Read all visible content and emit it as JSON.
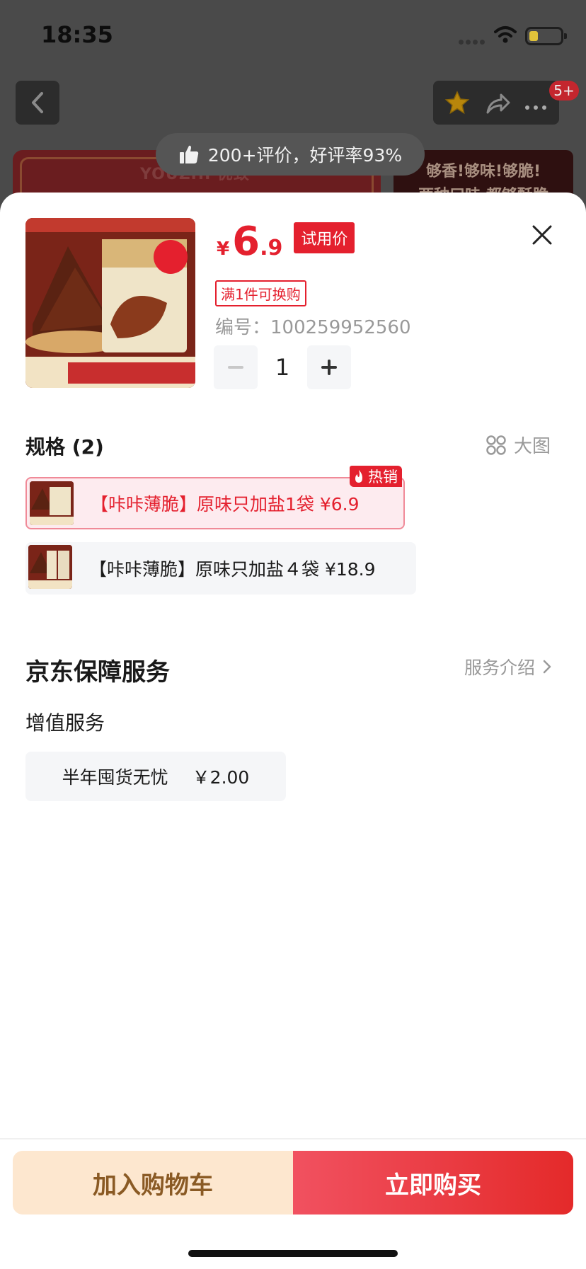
{
  "status_bar": {
    "time": "18:35"
  },
  "top_nav": {
    "cart_badge": "5+"
  },
  "rating": {
    "text": "200+评价，好评率93%"
  },
  "banner": {
    "brand": "YOUZHI 优致",
    "slogan_line1": "够香!够味!够脆!",
    "slogan_line2": "两种口味 都够酥脆"
  },
  "product": {
    "price_symbol": "¥",
    "price_integer": "6",
    "price_decimal": ".9",
    "price_badge": "试用价",
    "exchange_tag": "满1件可换购",
    "sku_id": "编号：100259952560",
    "quantity": "1"
  },
  "specs": {
    "title": "规格 (2)",
    "big_image_label": "大图",
    "hot_label": "热销",
    "options": [
      {
        "label": "【咔咔薄脆】原味只加盐1袋  ¥6.9",
        "selected": true
      },
      {
        "label": "【咔咔薄脆】原味只加盐４袋  ¥18.9",
        "selected": false
      }
    ]
  },
  "service": {
    "title": "京东保障服务",
    "intro_label": "服务介绍",
    "value_added_title": "增值服务",
    "option_name": "半年囤货无忧",
    "option_price": "￥2.00"
  },
  "actions": {
    "add_to_cart": "加入购物车",
    "buy_now": "立即购买"
  },
  "colors": {
    "accent": "#e4202e",
    "cart_bg": "#fde7cf",
    "cart_text": "#8a5a24"
  }
}
